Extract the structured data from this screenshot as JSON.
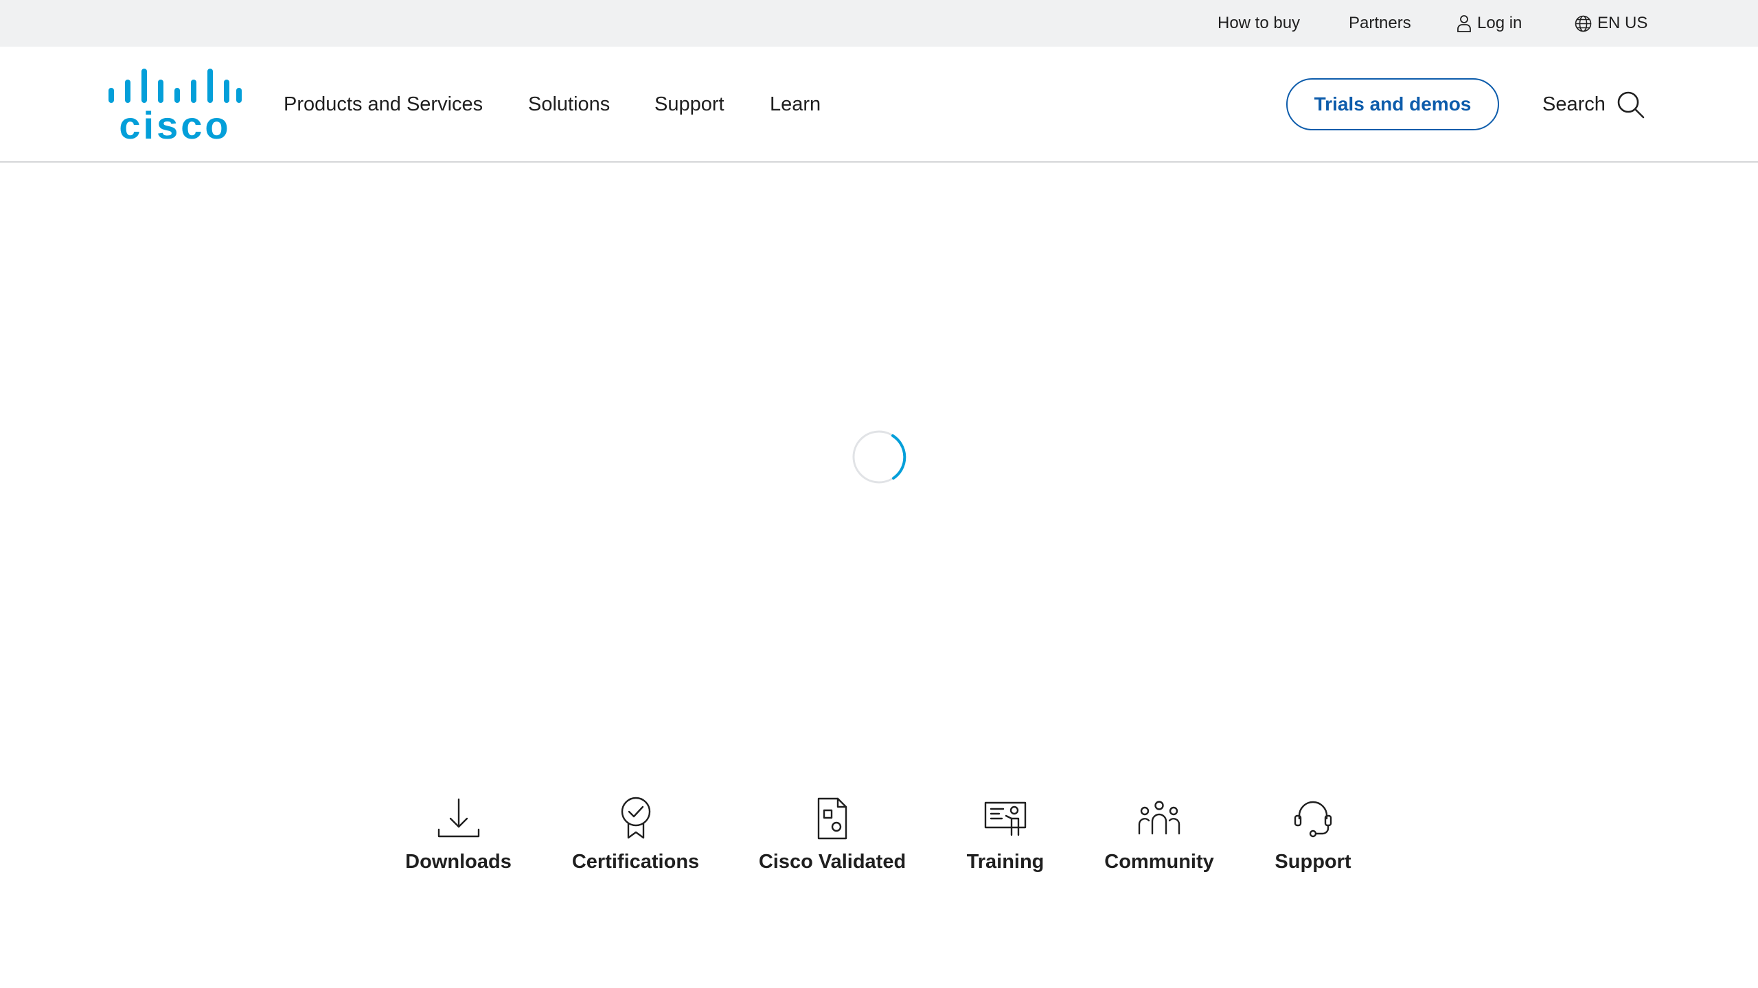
{
  "utility": {
    "how_to_buy": "How to buy",
    "partners": "Partners",
    "log_in": "Log in",
    "language": "EN US"
  },
  "header": {
    "logo_text": "cisco",
    "nav": {
      "products": "Products and Services",
      "solutions": "Solutions",
      "support": "Support",
      "learn": "Learn"
    },
    "trials_label": "Trials and demos",
    "search_label": "Search"
  },
  "quick_links": {
    "downloads": "Downloads",
    "certifications": "Certifications",
    "cisco_validated": "Cisco Validated",
    "training": "Training",
    "community": "Community",
    "support": "Support"
  },
  "icons": {
    "user": "user-icon",
    "globe": "globe-icon",
    "search": "search-icon",
    "download": "download-icon",
    "certification": "certification-badge-icon",
    "validated": "document-icon",
    "training": "presentation-board-icon",
    "community": "people-group-icon",
    "support": "headset-icon"
  },
  "colors": {
    "brand": "#049fd9",
    "accent": "#0d5cab",
    "utility_bg": "#f0f1f2",
    "text": "#1f1f1f"
  }
}
